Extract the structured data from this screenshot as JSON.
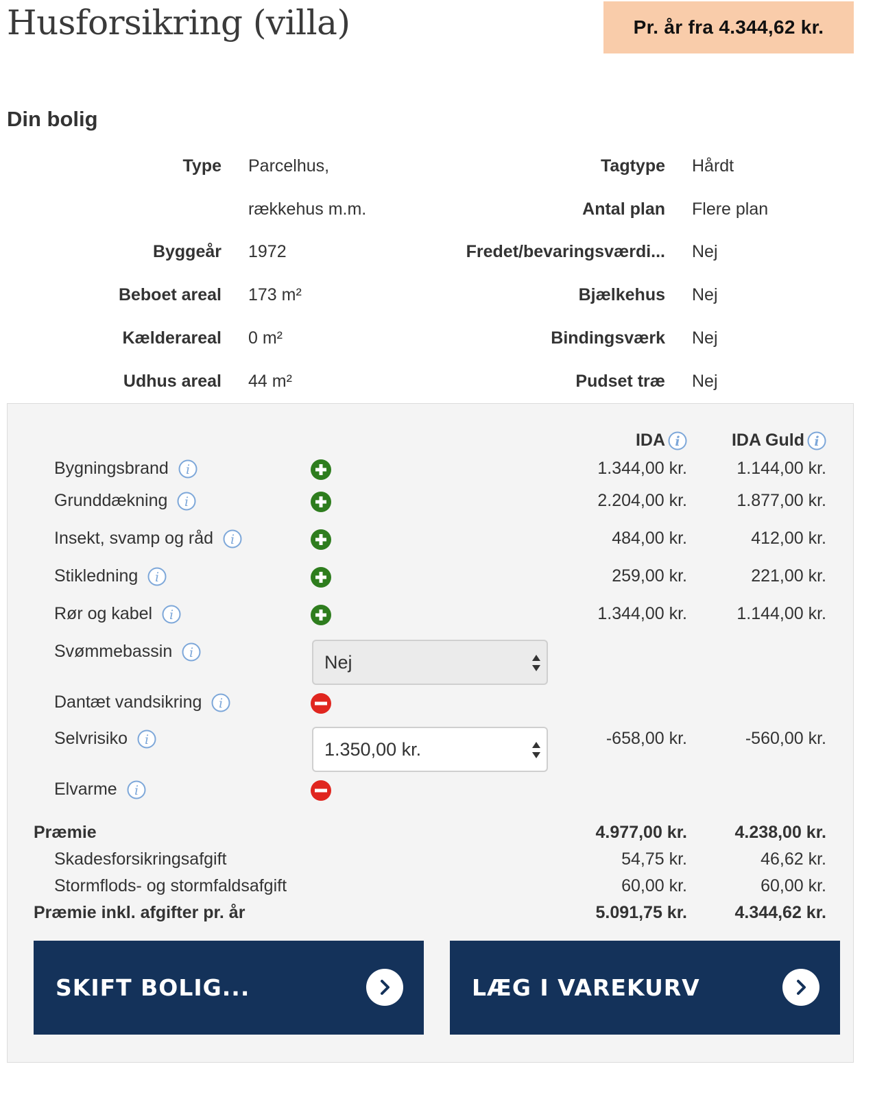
{
  "header": {
    "title": "Husforsikring (villa)",
    "price_badge": "Pr. år fra 4.344,62 kr."
  },
  "dwelling": {
    "title": "Din bolig",
    "left": [
      {
        "label": "Type",
        "value": "Parcelhus,"
      },
      {
        "label": "",
        "value": "rækkehus m.m."
      },
      {
        "label": "Byggeår",
        "value": "1972"
      },
      {
        "label": "Beboet areal",
        "value": "173 m²"
      },
      {
        "label": "Kælderareal",
        "value": "0 m²"
      },
      {
        "label": "Udhus areal",
        "value": "44 m²"
      }
    ],
    "right": [
      {
        "label": "Tagtype",
        "value": "Hårdt"
      },
      {
        "label": "Antal plan",
        "value": "Flere plan"
      },
      {
        "label": "Fredet/bevaringsværdi...",
        "value": "Nej"
      },
      {
        "label": "Bjælkehus",
        "value": "Nej"
      },
      {
        "label": "Bindingsværk",
        "value": "Nej"
      },
      {
        "label": "Pudset træ",
        "value": "Nej"
      }
    ]
  },
  "columns": {
    "ida": "IDA",
    "ida_guld": "IDA Guld"
  },
  "coverages": [
    {
      "label": "Bygningsbrand",
      "state": "added",
      "ida": "1.344,00 kr.",
      "guld": "1.144,00 kr."
    },
    {
      "label": "Grunddækning",
      "state": "added",
      "ida": "2.204,00 kr.",
      "guld": "1.877,00 kr."
    },
    {
      "label": "Insekt, svamp og råd",
      "state": "added",
      "ida": "484,00 kr.",
      "guld": "412,00 kr."
    },
    {
      "label": "Stikledning",
      "state": "added",
      "ida": "259,00 kr.",
      "guld": "221,00 kr."
    },
    {
      "label": "Rør og kabel",
      "state": "added",
      "ida": "1.344,00 kr.",
      "guld": "1.144,00 kr."
    },
    {
      "label": "Svømmebassin",
      "select": "Nej"
    },
    {
      "label": "Dantæt vandsikring",
      "state": "removed"
    },
    {
      "label": "Selvrisiko",
      "select": "1.350,00 kr.",
      "ida": "-658,00 kr.",
      "guld": "-560,00 kr."
    },
    {
      "label": "Elvarme",
      "state": "removed"
    }
  ],
  "summary": [
    {
      "label": "Præmie",
      "ida": "4.977,00 kr.",
      "guld": "4.238,00 kr.",
      "bold": true
    },
    {
      "label": "Skadesforsikringsafgift",
      "ida": "54,75 kr.",
      "guld": "46,62 kr."
    },
    {
      "label": "Stormflods- og stormfaldsafgift",
      "ida": "60,00 kr.",
      "guld": "60,00 kr."
    },
    {
      "label": "Præmie inkl. afgifter pr. år",
      "ida": "5.091,75 kr.",
      "guld": "4.344,62 kr.",
      "bold": true
    }
  ],
  "actions": {
    "change_home": "SKIFT BOLIG...",
    "add_to_cart": "LÆG I VAREKURV"
  },
  "colors": {
    "badge_bg": "#f9ccaa",
    "button_bg": "#14325a",
    "add_green": "#2e7d1e",
    "remove_red": "#e0261f",
    "info_blue": "#7da7d9"
  }
}
